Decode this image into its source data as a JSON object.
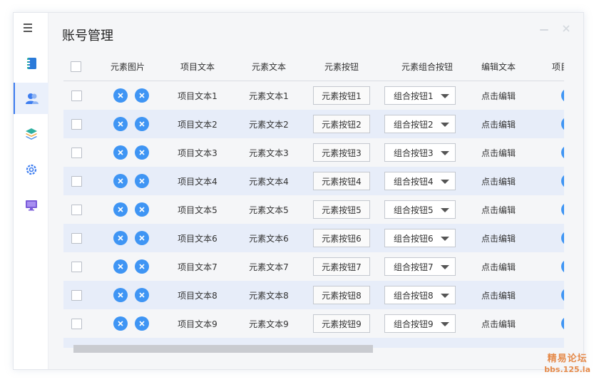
{
  "page_title": "账号管理",
  "nav": {
    "items": [
      {
        "name": "notebook",
        "icon": "notebook-icon"
      },
      {
        "name": "account",
        "icon": "user-icon",
        "active": true
      },
      {
        "name": "layers",
        "icon": "layers-icon"
      },
      {
        "name": "settings",
        "icon": "gear-icon"
      },
      {
        "name": "display",
        "icon": "monitor-icon"
      }
    ]
  },
  "table": {
    "headers": [
      "元素图片",
      "项目文本",
      "元素文本",
      "元素按钮",
      "元素组合按钮",
      "编辑文本",
      "项目"
    ],
    "rows": [
      {
        "item_text": "项目文本1",
        "element_text": "元素文本1",
        "button": "元素按钮1",
        "combo": "组合按钮1",
        "edit": "点击编辑"
      },
      {
        "item_text": "项目文本2",
        "element_text": "元素文本2",
        "button": "元素按钮2",
        "combo": "组合按钮2",
        "edit": "点击编辑"
      },
      {
        "item_text": "项目文本3",
        "element_text": "元素文本3",
        "button": "元素按钮3",
        "combo": "组合按钮3",
        "edit": "点击编辑"
      },
      {
        "item_text": "项目文本4",
        "element_text": "元素文本4",
        "button": "元素按钮4",
        "combo": "组合按钮4",
        "edit": "点击编辑"
      },
      {
        "item_text": "项目文本5",
        "element_text": "元素文本5",
        "button": "元素按钮5",
        "combo": "组合按钮5",
        "edit": "点击编辑"
      },
      {
        "item_text": "项目文本6",
        "element_text": "元素文本6",
        "button": "元素按钮6",
        "combo": "组合按钮6",
        "edit": "点击编辑"
      },
      {
        "item_text": "项目文本7",
        "element_text": "元素文本7",
        "button": "元素按钮7",
        "combo": "组合按钮7",
        "edit": "点击编辑"
      },
      {
        "item_text": "项目文本8",
        "element_text": "元素文本8",
        "button": "元素按钮8",
        "combo": "组合按钮8",
        "edit": "点击编辑"
      },
      {
        "item_text": "项目文本9",
        "element_text": "元素文本9",
        "button": "元素按钮9",
        "combo": "组合按钮9",
        "edit": "点击编辑"
      }
    ]
  },
  "colors": {
    "accent": "#3f95f4",
    "row_alt": "#e7edf9",
    "nav_active": "#3d7df0"
  },
  "watermark": {
    "line1": "精易论坛",
    "line2": "bbs.125.la"
  }
}
